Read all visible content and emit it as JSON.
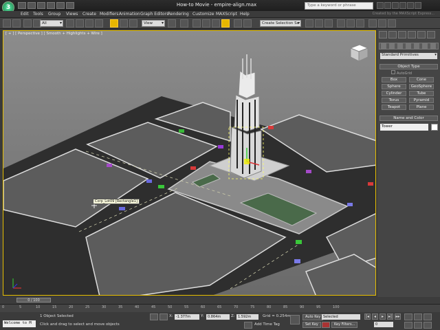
{
  "window": {
    "title": "How-to Movie - empire-align.max"
  },
  "search": {
    "placeholder": "Type a keyword or phrase"
  },
  "copyright": "Created by the MAXScript Express...",
  "menu": [
    "Edit",
    "Tools",
    "Group",
    "Views",
    "Create",
    "Modifiers",
    "Animation",
    "Graph Editors",
    "Rendering",
    "Customize",
    "MAXScript",
    "Help"
  ],
  "toolbar": {
    "selection_filter": "All",
    "ref_coord": "View",
    "named_selection": "Create Selection Se"
  },
  "viewport": {
    "label": "[ + ] [ Perspective ] [ Smooth + Highlights + Wire ]",
    "tooltip": "Corp_Lot09 [Rectangle1]"
  },
  "command_panel": {
    "category": "Standard Primitives",
    "object_type_title": "Object Type",
    "autogrid": "AutoGrid",
    "buttons": [
      "Box",
      "Cone",
      "Sphere",
      "GeoSphere",
      "Cylinder",
      "Tube",
      "Torus",
      "Pyramid",
      "Teapot",
      "Plane"
    ],
    "name_color_title": "Name and Color",
    "name_value": "Tower",
    "colors": {
      "swatch": "#ffffff"
    }
  },
  "timeline": {
    "slider": "0 / 100",
    "ticks": [
      "0",
      "5",
      "10",
      "15",
      "20",
      "25",
      "30",
      "35",
      "40",
      "45",
      "50",
      "55",
      "60",
      "65",
      "70",
      "75",
      "80",
      "85",
      "90",
      "95",
      "100"
    ]
  },
  "status": {
    "listener": "Welcome to M",
    "selected": "1 Object Selected",
    "prompt": "Click and drag to select and move objects",
    "x_label": "X:",
    "x_value": "-1.377m",
    "y_label": "Y:",
    "y_value": "0.864m",
    "z_label": "Z:",
    "z_value": "1.592m",
    "grid": "Grid = 0.254m",
    "add_time_tag": "Add Time Tag",
    "auto_key": "Auto Key",
    "set_key": "Set Key",
    "key_mode": "Selected",
    "key_filters": "Key Filters...",
    "frame": "0"
  }
}
